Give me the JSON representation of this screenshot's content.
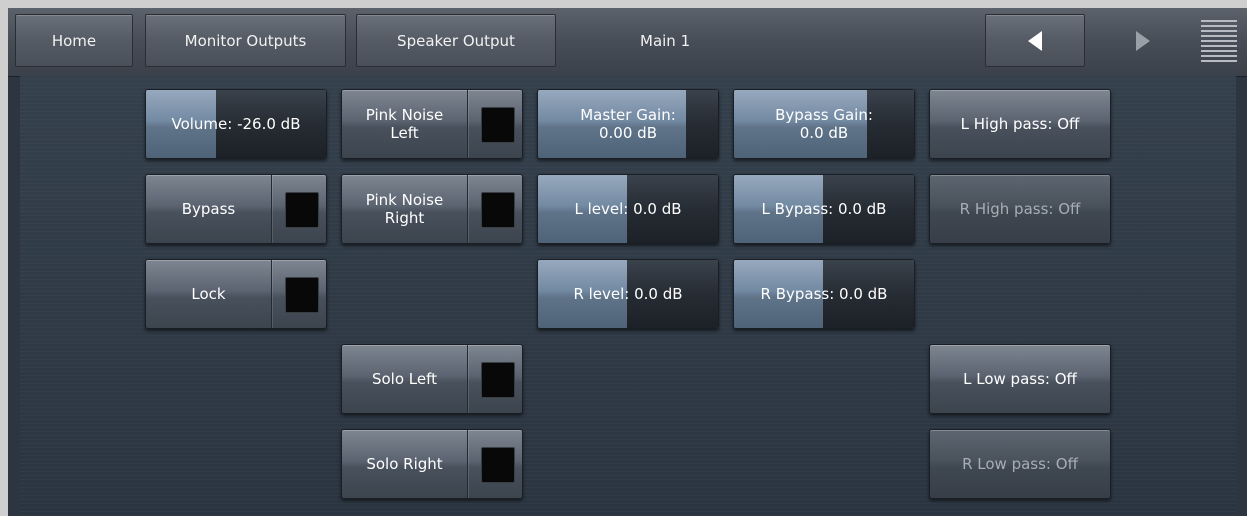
{
  "topbar": {
    "tabs": [
      "Home",
      "Monitor Outputs",
      "Speaker Output"
    ],
    "current": "Main 1",
    "icons": {
      "back": "triangle-left-icon",
      "forward": "triangle-right-icon",
      "menu": "hamburger-menu-icon"
    },
    "colors": {
      "active_arrow": "#ffffff",
      "inactive_arrow": "#9aa0a8"
    }
  },
  "controls": {
    "volume": {
      "label": "Volume: -26.0 dB",
      "level": 0.4
    },
    "bypass": {
      "label": "Bypass",
      "on": false
    },
    "lock": {
      "label": "Lock",
      "on": false
    },
    "pink_left": {
      "label_line1": "Pink Noise",
      "label_line2": "Left",
      "on": false
    },
    "pink_right": {
      "label_line1": "Pink Noise",
      "label_line2": "Right",
      "on": false
    },
    "solo_left": {
      "label": "Solo Left",
      "on": false
    },
    "solo_right": {
      "label": "Solo Right",
      "on": false
    },
    "master_gain": {
      "label_line1": "Master Gain:",
      "label_line2": "0.00 dB",
      "level": 0.83
    },
    "l_level": {
      "label": "L level: 0.0 dB",
      "level": 0.5
    },
    "r_level": {
      "label": "R level: 0.0 dB",
      "level": 0.5
    },
    "bypass_gain": {
      "label_line1": "Bypass Gain:",
      "label_line2": "0.0 dB",
      "level": 0.74
    },
    "l_bypass": {
      "label": "L Bypass: 0.0 dB",
      "level": 0.5
    },
    "r_bypass": {
      "label": "R Bypass: 0.0 dB",
      "level": 0.5
    },
    "l_high_pass": {
      "label": "L High pass: Off"
    },
    "r_high_pass": {
      "label": "R High pass: Off"
    },
    "l_low_pass": {
      "label": "L Low pass: Off"
    },
    "r_low_pass": {
      "label": "R Low pass: Off"
    }
  }
}
